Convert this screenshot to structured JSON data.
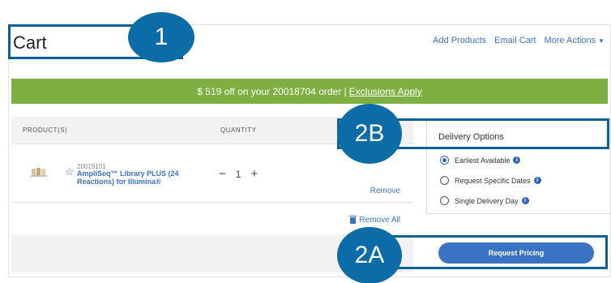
{
  "header": {
    "title": "Cart",
    "links": [
      "Add Products",
      "Email Cart",
      "More Actions"
    ]
  },
  "promo": {
    "text": "$ 519 off on your 20018704 order |",
    "link": "Exclusions Apply"
  },
  "cart": {
    "columns": {
      "product": "PRODUCT(S)",
      "quantity": "QUANTITY"
    },
    "item": {
      "sku": "20019101",
      "name": "AmpliSeq™ Library PLUS (24 Reactions) for Illumina®",
      "quantity": "1",
      "minus": "−",
      "plus": "+",
      "remove": "Remove"
    },
    "remove_all": "Remove All"
  },
  "delivery": {
    "title": "Delivery Options",
    "options": [
      "Earliest Available",
      "Request Specific Dates",
      "Single Delivery Day"
    ],
    "selected": "Earliest Available",
    "info_glyph": "i"
  },
  "request_button": "Request Pricing",
  "callouts": {
    "c1": "1",
    "c2b": "2B",
    "c2a": "2A"
  },
  "colors": {
    "promo": "#7db040",
    "accent": "#3a73c4",
    "callout": "#0c6ca8"
  }
}
